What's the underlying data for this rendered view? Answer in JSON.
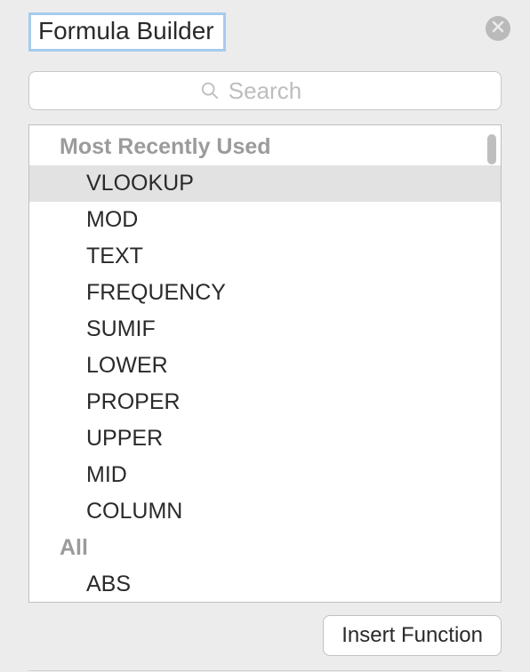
{
  "title": "Formula Builder",
  "search": {
    "placeholder": "Search"
  },
  "groups": [
    {
      "label": "Most Recently Used",
      "items": [
        {
          "label": "VLOOKUP",
          "selected": true
        },
        {
          "label": "MOD",
          "selected": false
        },
        {
          "label": "TEXT",
          "selected": false
        },
        {
          "label": "FREQUENCY",
          "selected": false
        },
        {
          "label": "SUMIF",
          "selected": false
        },
        {
          "label": "LOWER",
          "selected": false
        },
        {
          "label": "PROPER",
          "selected": false
        },
        {
          "label": "UPPER",
          "selected": false
        },
        {
          "label": "MID",
          "selected": false
        },
        {
          "label": "COLUMN",
          "selected": false
        }
      ]
    },
    {
      "label": "All",
      "items": [
        {
          "label": "ABS",
          "selected": false
        }
      ]
    }
  ],
  "buttons": {
    "insert": "Insert Function"
  }
}
